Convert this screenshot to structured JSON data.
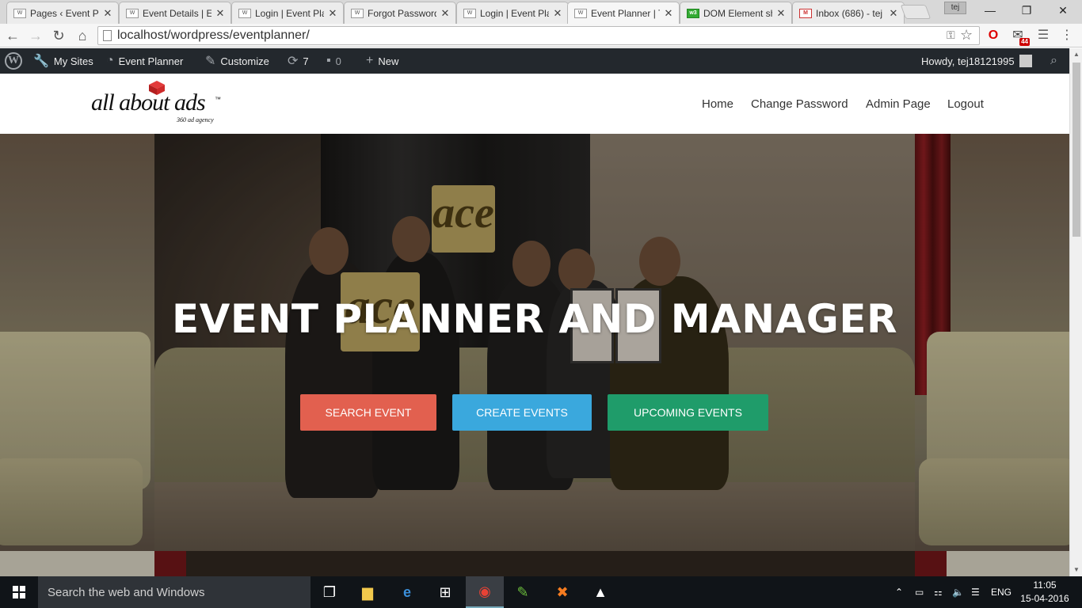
{
  "browser": {
    "tabs": [
      {
        "title": "Pages ‹ Event Pla",
        "favicon": "wordpress-icon"
      },
      {
        "title": "Event Details | Ev",
        "favicon": "wordpress-icon"
      },
      {
        "title": "Login | Event Pla",
        "favicon": "wordpress-icon"
      },
      {
        "title": "Forgot Password",
        "favicon": "wordpress-icon"
      },
      {
        "title": "Login | Event Pla",
        "favicon": "wordpress-icon"
      },
      {
        "title": "Event Planner | T",
        "favicon": "wordpress-icon",
        "active": true
      },
      {
        "title": "DOM Element sh",
        "favicon": "w3schools-icon"
      },
      {
        "title": "Inbox (686) - tej",
        "favicon": "gmail-icon"
      }
    ],
    "profile_label": "tej",
    "url": "localhost/wordpress/eventplanner/",
    "mail_badge": "44"
  },
  "adminbar": {
    "my_sites": "My Sites",
    "site_name": "Event Planner",
    "customize": "Customize",
    "updates_count": "7",
    "comments_count": "0",
    "new_label": "New",
    "howdy": "Howdy, tej18121995"
  },
  "site": {
    "logo_text": "all about ads",
    "logo_tm": "™",
    "logo_tagline": "360 ad agency",
    "nav": [
      "Home",
      "Change Password",
      "Admin Page",
      "Logout"
    ]
  },
  "hero": {
    "title": "EVENT PLANNER AND MANAGER",
    "trophy_text": "ace",
    "buttons": [
      {
        "label": "SEARCH EVENT",
        "color": "#e2604f"
      },
      {
        "label": "CREATE EVENTS",
        "color": "#3aa8dd"
      },
      {
        "label": "UPCOMING EVENTS",
        "color": "#1f9c6a"
      }
    ]
  },
  "taskbar": {
    "search_placeholder": "Search the web and Windows",
    "language": "ENG",
    "time": "11:05",
    "date": "15-04-2016"
  },
  "colors": {
    "adminbar_bg": "#23282d",
    "taskbar_bg": "#101418"
  }
}
